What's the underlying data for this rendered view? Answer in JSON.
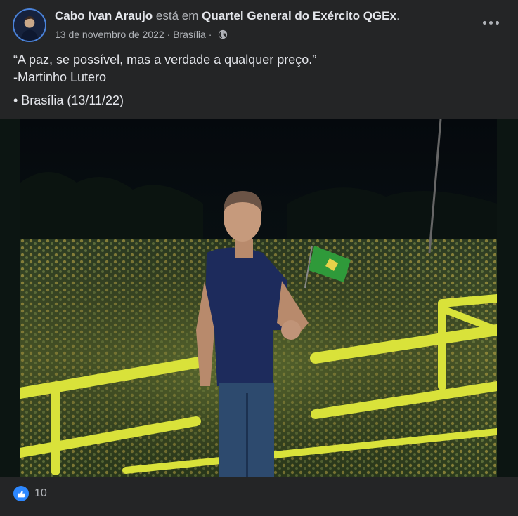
{
  "post": {
    "author_name": "Cabo Ivan Araujo",
    "verb": "está em",
    "place": "Quartel General do Exército QGEx",
    "place_suffix": ".",
    "date": "13 de novembro de 2022",
    "separator": " · ",
    "location": "Brasília",
    "separator_end": " · ",
    "privacy_icon": "globe-icon",
    "more_icon": "more-options-icon",
    "text_lines": [
      "“A paz, se possível, mas a verdade a qualquer preço.”",
      "-Martinho Lutero",
      "• Brasília (13/11/22)"
    ]
  },
  "photo": {
    "description_icon": "photo"
  },
  "reactions": {
    "icon": "like-icon",
    "count": "10"
  },
  "colors": {
    "background": "#242526",
    "text_primary": "#e4e6eb",
    "text_secondary": "#b0b3b8",
    "like_blue": "#2d88ff"
  }
}
